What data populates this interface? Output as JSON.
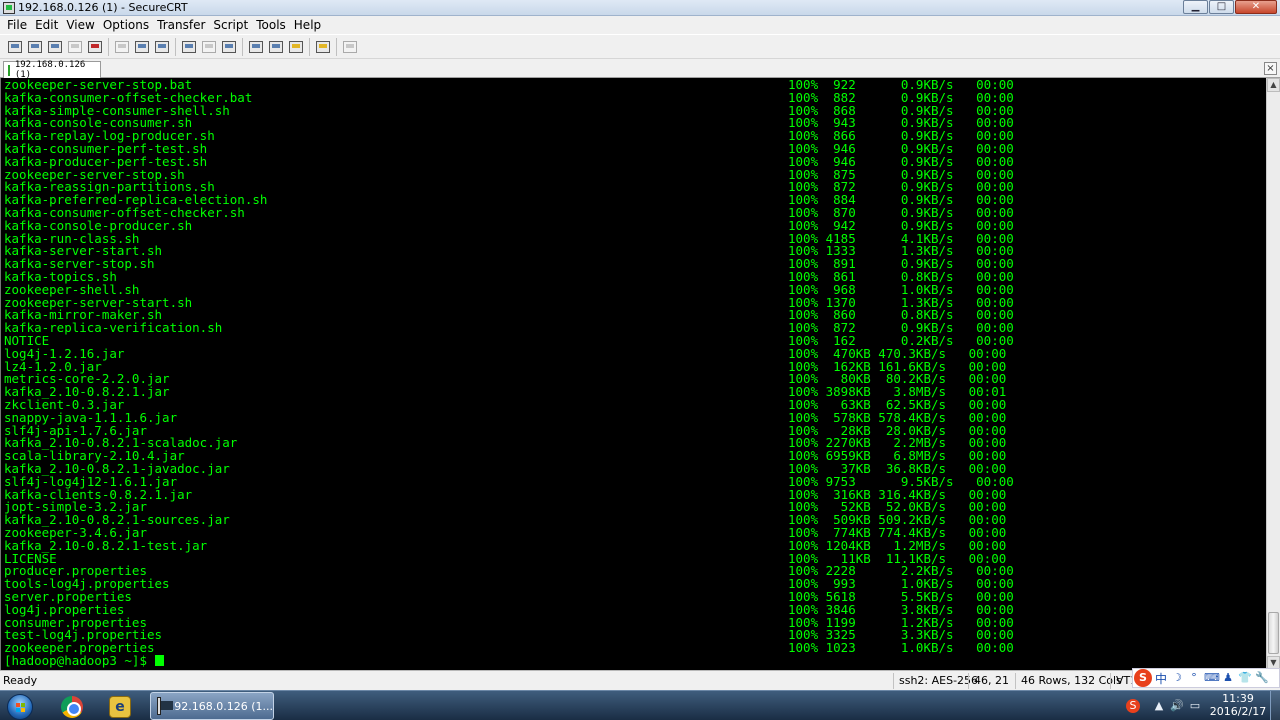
{
  "window": {
    "title": "192.168.0.126 (1) - SecureCRT",
    "minimize_glyph": "▁",
    "maximize_glyph": "□",
    "close_glyph": "✕"
  },
  "menu": [
    "File",
    "Edit",
    "View",
    "Options",
    "Transfer",
    "Script",
    "Tools",
    "Help"
  ],
  "tab": {
    "label": "192.168.0.126  (1)",
    "close_glyph": "×"
  },
  "terminal": {
    "lines": [
      {
        "name": "zookeeper-server-stop.bat",
        "stat": "100%  922      0.9KB/s   00:00"
      },
      {
        "name": "kafka-consumer-offset-checker.bat",
        "stat": "100%  882      0.9KB/s   00:00"
      },
      {
        "name": "kafka-simple-consumer-shell.sh",
        "stat": "100%  868      0.9KB/s   00:00"
      },
      {
        "name": "kafka-console-consumer.sh",
        "stat": "100%  943      0.9KB/s   00:00"
      },
      {
        "name": "kafka-replay-log-producer.sh",
        "stat": "100%  866      0.9KB/s   00:00"
      },
      {
        "name": "kafka-consumer-perf-test.sh",
        "stat": "100%  946      0.9KB/s   00:00"
      },
      {
        "name": "kafka-producer-perf-test.sh",
        "stat": "100%  946      0.9KB/s   00:00"
      },
      {
        "name": "zookeeper-server-stop.sh",
        "stat": "100%  875      0.9KB/s   00:00"
      },
      {
        "name": "kafka-reassign-partitions.sh",
        "stat": "100%  872      0.9KB/s   00:00"
      },
      {
        "name": "kafka-preferred-replica-election.sh",
        "stat": "100%  884      0.9KB/s   00:00"
      },
      {
        "name": "kafka-consumer-offset-checker.sh",
        "stat": "100%  870      0.9KB/s   00:00"
      },
      {
        "name": "kafka-console-producer.sh",
        "stat": "100%  942      0.9KB/s   00:00"
      },
      {
        "name": "kafka-run-class.sh",
        "stat": "100% 4185      4.1KB/s   00:00"
      },
      {
        "name": "kafka-server-start.sh",
        "stat": "100% 1333      1.3KB/s   00:00"
      },
      {
        "name": "kafka-server-stop.sh",
        "stat": "100%  891      0.9KB/s   00:00"
      },
      {
        "name": "kafka-topics.sh",
        "stat": "100%  861      0.8KB/s   00:00"
      },
      {
        "name": "zookeeper-shell.sh",
        "stat": "100%  968      1.0KB/s   00:00"
      },
      {
        "name": "zookeeper-server-start.sh",
        "stat": "100% 1370      1.3KB/s   00:00"
      },
      {
        "name": "kafka-mirror-maker.sh",
        "stat": "100%  860      0.8KB/s   00:00"
      },
      {
        "name": "kafka-replica-verification.sh",
        "stat": "100%  872      0.9KB/s   00:00"
      },
      {
        "name": "NOTICE",
        "stat": "100%  162      0.2KB/s   00:00"
      },
      {
        "name": "log4j-1.2.16.jar",
        "stat": "100%  470KB 470.3KB/s   00:00"
      },
      {
        "name": "lz4-1.2.0.jar",
        "stat": "100%  162KB 161.6KB/s   00:00"
      },
      {
        "name": "metrics-core-2.2.0.jar",
        "stat": "100%   80KB  80.2KB/s   00:00"
      },
      {
        "name": "kafka_2.10-0.8.2.1.jar",
        "stat": "100% 3898KB   3.8MB/s   00:01"
      },
      {
        "name": "zkclient-0.3.jar",
        "stat": "100%   63KB  62.5KB/s   00:00"
      },
      {
        "name": "snappy-java-1.1.1.6.jar",
        "stat": "100%  578KB 578.4KB/s   00:00"
      },
      {
        "name": "slf4j-api-1.7.6.jar",
        "stat": "100%   28KB  28.0KB/s   00:00"
      },
      {
        "name": "kafka_2.10-0.8.2.1-scaladoc.jar",
        "stat": "100% 2270KB   2.2MB/s   00:00"
      },
      {
        "name": "scala-library-2.10.4.jar",
        "stat": "100% 6959KB   6.8MB/s   00:00"
      },
      {
        "name": "kafka_2.10-0.8.2.1-javadoc.jar",
        "stat": "100%   37KB  36.8KB/s   00:00"
      },
      {
        "name": "slf4j-log4j12-1.6.1.jar",
        "stat": "100% 9753      9.5KB/s   00:00"
      },
      {
        "name": "kafka-clients-0.8.2.1.jar",
        "stat": "100%  316KB 316.4KB/s   00:00"
      },
      {
        "name": "jopt-simple-3.2.jar",
        "stat": "100%   52KB  52.0KB/s   00:00"
      },
      {
        "name": "kafka_2.10-0.8.2.1-sources.jar",
        "stat": "100%  509KB 509.2KB/s   00:00"
      },
      {
        "name": "zookeeper-3.4.6.jar",
        "stat": "100%  774KB 774.4KB/s   00:00"
      },
      {
        "name": "kafka_2.10-0.8.2.1-test.jar",
        "stat": "100% 1204KB   1.2MB/s   00:00"
      },
      {
        "name": "LICENSE",
        "stat": "100%   11KB  11.1KB/s   00:00"
      },
      {
        "name": "producer.properties",
        "stat": "100% 2228      2.2KB/s   00:00"
      },
      {
        "name": "tools-log4j.properties",
        "stat": "100%  993      1.0KB/s   00:00"
      },
      {
        "name": "server.properties",
        "stat": "100% 5618      5.5KB/s   00:00"
      },
      {
        "name": "log4j.properties",
        "stat": "100% 3846      3.8KB/s   00:00"
      },
      {
        "name": "consumer.properties",
        "stat": "100% 1199      1.2KB/s   00:00"
      },
      {
        "name": "test-log4j.properties",
        "stat": "100% 3325      3.3KB/s   00:00"
      },
      {
        "name": "zookeeper.properties",
        "stat": "100% 1023      1.0KB/s   00:00"
      }
    ],
    "prompt": "[hadoop@hadoop3 ~]$ "
  },
  "statusbar": {
    "ready": "Ready",
    "cipher": "ssh2: AES-256",
    "position": "46,  21",
    "size": "46 Rows, 132 Cols",
    "terminal_type": "VT100"
  },
  "ime": {
    "logo": "S",
    "lang": "中",
    "icons": [
      "☽",
      "°",
      "⌨",
      "♟",
      "👕",
      "🔧"
    ]
  },
  "taskbar": {
    "active_window_label": "192.168.0.126 (1...",
    "ie_glyph": "e",
    "tray_icons": [
      "S",
      "▲",
      "🔊",
      "▭"
    ],
    "clock_time": "11:39",
    "clock_date": "2016/2/17"
  },
  "colors": {
    "terminal_bg": "#000000",
    "terminal_fg": "#00ff00"
  }
}
